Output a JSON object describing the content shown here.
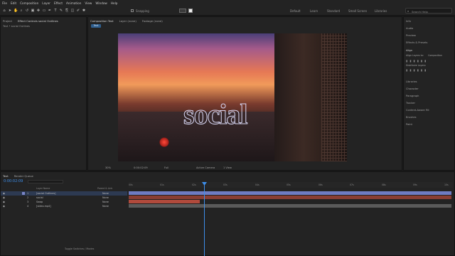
{
  "menu": [
    "File",
    "Edit",
    "Composition",
    "Layer",
    "Effect",
    "Animation",
    "View",
    "Window",
    "Help"
  ],
  "toolbar": {
    "snapping_label": "Snapping",
    "workspaces": [
      "Default",
      "Learn",
      "Standard",
      "Small Screen",
      "Libraries"
    ],
    "active_workspace": "Default",
    "search_placeholder": "Search Help"
  },
  "project_panel": {
    "tab": "Project",
    "effect_controls_tab": "Effect Controls social Outlines",
    "subtitle": "Text • social Outlines"
  },
  "composition_panel": {
    "tab": "Composition Text",
    "layer_tab": "Layer (none)",
    "footage_tab": "Footage (none)",
    "comp_button": "Text",
    "title_text": "social",
    "footer": {
      "zoom": "30%",
      "timecode": "0:00:02:09",
      "resolution": "Full",
      "camera": "Active Camera",
      "view": "1 View"
    }
  },
  "right_panel": {
    "items": [
      "Info",
      "Audio",
      "Preview",
      "Effects & Presets",
      "Align"
    ],
    "align_to_label": "Align Layers to:",
    "align_to_value": "Composition",
    "distribute_label": "Distribute Layers:",
    "lower_items": [
      "Libraries",
      "Character",
      "Paragraph",
      "Tracker",
      "Content-Aware Fill",
      "Brushes",
      "Paint"
    ]
  },
  "timeline": {
    "tab": "Text",
    "render_queue_tab": "Render Queue",
    "timecode": "0:00:02:09",
    "col_source": "Layer Name",
    "col_parent": "Parent & Link",
    "layers": [
      {
        "num": "1",
        "name": "[social Outlines]",
        "parent": "None",
        "color": "#7a86c8"
      },
      {
        "num": "2",
        "name": "social",
        "parent": "None",
        "color": "#c85a5a"
      },
      {
        "num": "3",
        "name": "Swap",
        "parent": "None",
        "color": "#c85a5a"
      },
      {
        "num": "4",
        "name": "[video.mp4]",
        "parent": "None",
        "color": "#6a6a6a"
      }
    ],
    "ruler": [
      "00s",
      "01s",
      "02s",
      "03s",
      "04s",
      "05s",
      "06s",
      "07s",
      "08s",
      "09s",
      "10s"
    ],
    "footer_label": "Toggle Switches / Modes",
    "colors": {
      "playhead": "#3d8eea",
      "outline_bar": "#6e7cc4",
      "text_bar": "#b04a3c",
      "video_bar": "#5a5a5a"
    }
  }
}
